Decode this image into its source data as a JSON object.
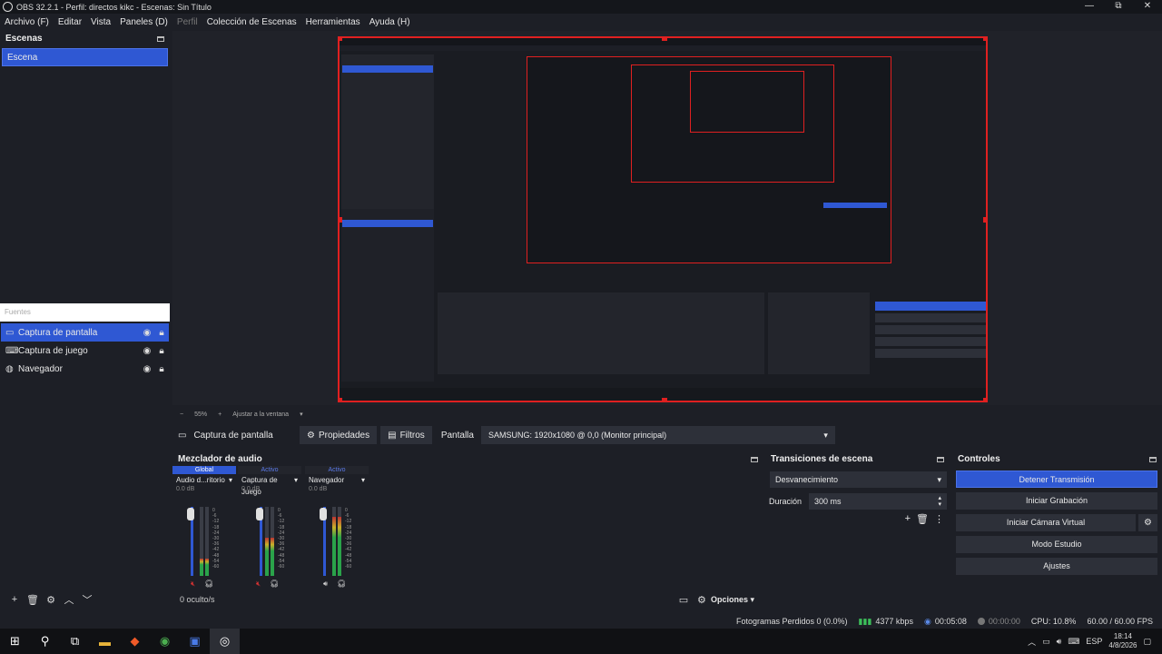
{
  "window": {
    "title": "OBS 32.2.1 - Perfil: directos kikc - Escenas: Sin Título",
    "minimize": "—",
    "maximize": "⧉",
    "close": "✕"
  },
  "menu": [
    {
      "label": "Archivo (F)",
      "dim": false
    },
    {
      "label": "Editar",
      "dim": false
    },
    {
      "label": "Vista",
      "dim": false
    },
    {
      "label": "Paneles (D)",
      "dim": false
    },
    {
      "label": "Perfil",
      "dim": true
    },
    {
      "label": "Colección de Escenas",
      "dim": false
    },
    {
      "label": "Herramientas",
      "dim": false
    },
    {
      "label": "Ayuda (H)",
      "dim": false
    }
  ],
  "scenes": {
    "title": "Escenas",
    "items": [
      "Escena"
    ]
  },
  "sources": {
    "search_placeholder": "Fuentes",
    "items": [
      {
        "label": "Captura de pantalla",
        "icon": "monitor-icon",
        "selected": true
      },
      {
        "label": "Captura de juego",
        "icon": "gamepad-icon",
        "selected": false
      },
      {
        "label": "Navegador",
        "icon": "globe-icon",
        "selected": false
      }
    ]
  },
  "preview_zoom": {
    "minus": "−",
    "zoom": "55%",
    "plus": "+",
    "fit": "Ajustar a la ventana"
  },
  "context_bar": {
    "source": "Captura de pantalla",
    "properties": "Propiedades",
    "filters": "Filtros",
    "display_label": "Pantalla",
    "display_value": "SAMSUNG: 1920x1080 @ 0,0 (Monitor principal)"
  },
  "mixer": {
    "title": "Mezclador de audio",
    "hidden_label": "0 oculto/s",
    "options_label": "Opciones",
    "channels": [
      {
        "status": "Global",
        "name": "Audio d...ritorio",
        "db": "0.0 dB",
        "level": 0.25
      },
      {
        "status": "Activo",
        "name": "Captura de Juego",
        "db": "0.0 dB",
        "level": 0.55
      },
      {
        "status": "Activo",
        "name": "Navegador",
        "db": "0.0 dB",
        "level": 0.85
      }
    ],
    "ticks": [
      "0",
      "-6",
      "-12",
      "-18",
      "-24",
      "-30",
      "-36",
      "-42",
      "-48",
      "-54",
      "-60"
    ]
  },
  "transitions": {
    "title": "Transiciones de escena",
    "type": "Desvanecimiento",
    "duration_label": "Duración",
    "duration_value": "300 ms"
  },
  "controls": {
    "title": "Controles",
    "stop_stream": "Detener Transmisión",
    "start_recording": "Iniciar Grabación",
    "start_virtual_cam": "Iniciar Cámara Virtual",
    "studio_mode": "Modo Estudio",
    "settings": "Ajustes"
  },
  "status": {
    "dropped_frames": "Fotogramas Perdidos 0 (0.0%)",
    "bitrate": "4377 kbps",
    "stream_time": "00:05:08",
    "rec_time": "00:00:00",
    "cpu": "CPU: 10.8%",
    "fps": "60.00 / 60.00 FPS"
  },
  "taskbar": {
    "lang": "ESP",
    "time": "18:14",
    "date": "4/8/2026"
  }
}
